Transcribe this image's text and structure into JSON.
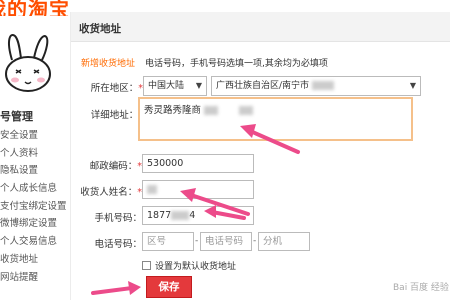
{
  "brand": {
    "logo_text": "我的淘宝"
  },
  "sidebar": {
    "section_title": "号管理",
    "items": [
      {
        "label": "安全设置"
      },
      {
        "label": "个人资料"
      },
      {
        "label": "隐私设置"
      },
      {
        "label": "个人成长信息"
      },
      {
        "label": "支付宝绑定设置"
      },
      {
        "label": "微博绑定设置"
      },
      {
        "label": "个人交易信息"
      },
      {
        "label": "收货地址"
      },
      {
        "label": "网站提醒"
      }
    ]
  },
  "panel": {
    "title": "收货地址",
    "new_address_label": "新增收货地址",
    "tip": "电话号码，手机号码选填一项,其余均为必填项"
  },
  "form": {
    "region": {
      "label": "所在地区：",
      "country": "中国大陆",
      "area": "广西壮族自治区/南宁市"
    },
    "detail": {
      "label": "详细地址：",
      "value": "秀灵路秀隆商"
    },
    "postcode": {
      "label": "邮政编码：",
      "value": "530000"
    },
    "name": {
      "label": "收货人姓名："
    },
    "mobile": {
      "label": "手机号码：",
      "value": "1877",
      "value_tail": "4"
    },
    "phone": {
      "label": "电话号码：",
      "area_placeholder": "区号",
      "number_placeholder": "电话号码",
      "ext_placeholder": "分机",
      "dash": "-"
    },
    "default": {
      "label": "设置为默认收货地址"
    },
    "required_mark": "*",
    "save_label": "保存"
  },
  "watermark": {
    "text": "Bai 百度 经验"
  },
  "colors": {
    "accent": "#ff6a00",
    "arrow": "#ec4b8a",
    "save_bg": "#e4393c",
    "highlight_border": "#f5c08a"
  }
}
